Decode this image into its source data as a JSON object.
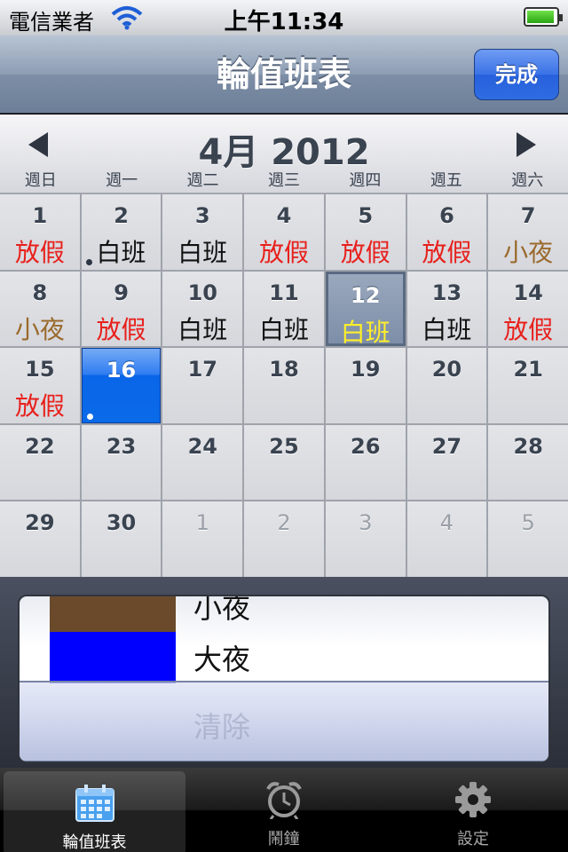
{
  "status_bar": {
    "carrier": "電信業者",
    "time": "上午11:34",
    "battery_level": 0.95
  },
  "nav": {
    "title": "輪值班表",
    "done_label": "完成"
  },
  "calendar": {
    "month_title": "4月 2012",
    "weekdays": [
      "週日",
      "週一",
      "週二",
      "週三",
      "週四",
      "週五",
      "週六"
    ],
    "days": [
      {
        "day": "1",
        "shift": "放假",
        "color": "red"
      },
      {
        "day": "2",
        "shift": "白班",
        "color": "black",
        "dot": true
      },
      {
        "day": "3",
        "shift": "白班",
        "color": "black"
      },
      {
        "day": "4",
        "shift": "放假",
        "color": "red"
      },
      {
        "day": "5",
        "shift": "放假",
        "color": "red"
      },
      {
        "day": "6",
        "shift": "放假",
        "color": "red"
      },
      {
        "day": "7",
        "shift": "小夜",
        "color": "brown"
      },
      {
        "day": "8",
        "shift": "小夜",
        "color": "brown"
      },
      {
        "day": "9",
        "shift": "放假",
        "color": "red"
      },
      {
        "day": "10",
        "shift": "白班",
        "color": "black"
      },
      {
        "day": "11",
        "shift": "白班",
        "color": "black"
      },
      {
        "day": "12",
        "shift": "白班",
        "color": "yellow",
        "state": "marked"
      },
      {
        "day": "13",
        "shift": "白班",
        "color": "black"
      },
      {
        "day": "14",
        "shift": "放假",
        "color": "red"
      },
      {
        "day": "15",
        "shift": "放假",
        "color": "red"
      },
      {
        "day": "16",
        "shift": "",
        "state": "selected",
        "dot": true
      },
      {
        "day": "17",
        "shift": ""
      },
      {
        "day": "18",
        "shift": ""
      },
      {
        "day": "19",
        "shift": ""
      },
      {
        "day": "20",
        "shift": ""
      },
      {
        "day": "21",
        "shift": ""
      },
      {
        "day": "22",
        "shift": ""
      },
      {
        "day": "23",
        "shift": ""
      },
      {
        "day": "24",
        "shift": ""
      },
      {
        "day": "25",
        "shift": ""
      },
      {
        "day": "26",
        "shift": ""
      },
      {
        "day": "27",
        "shift": ""
      },
      {
        "day": "28",
        "shift": ""
      },
      {
        "day": "29",
        "shift": ""
      },
      {
        "day": "30",
        "shift": ""
      },
      {
        "day": "1",
        "shift": "",
        "other": true
      },
      {
        "day": "2",
        "shift": "",
        "other": true
      },
      {
        "day": "3",
        "shift": "",
        "other": true
      },
      {
        "day": "4",
        "shift": "",
        "other": true
      },
      {
        "day": "5",
        "shift": "",
        "other": true
      }
    ]
  },
  "picker": {
    "items": [
      {
        "label": "小夜",
        "color": "#6b4a2b"
      },
      {
        "label": "大夜",
        "color": "#0000ff"
      },
      {
        "label": "清除",
        "color": ""
      }
    ],
    "selected": "清除"
  },
  "tabs": [
    {
      "label": "輪值班表",
      "icon": "calendar-icon",
      "active": true
    },
    {
      "label": "鬧鐘",
      "icon": "alarm-clock-icon",
      "active": false
    },
    {
      "label": "設定",
      "icon": "gear-icon",
      "active": false
    }
  ]
}
